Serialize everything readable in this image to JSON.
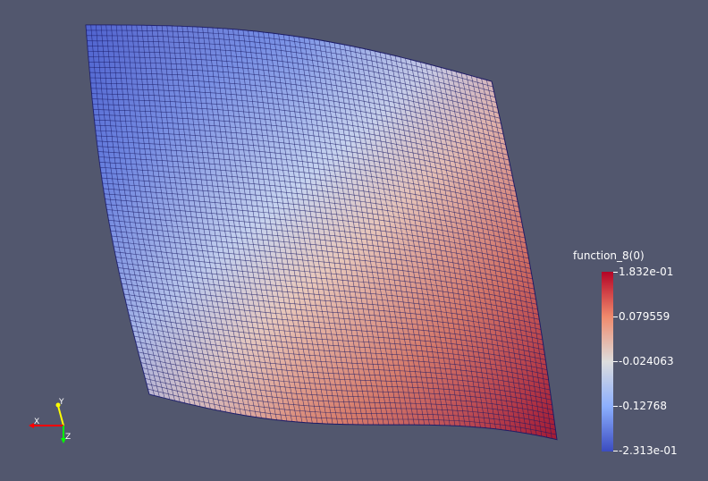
{
  "legend": {
    "title": "function_8(0)",
    "ticks": [
      "1.832e-01",
      "0.079559",
      "-0.024063",
      "-0.12768",
      "-2.313e-01"
    ],
    "colors": {
      "high": "#b40426",
      "mid": "#dddddd",
      "low": "#3b4cc0"
    }
  },
  "axes": {
    "x_label": "X",
    "y_label": "Y",
    "z_label": "Z",
    "x_color": "#ff0000",
    "y_color": "#ffff00",
    "z_color": "#00ff00"
  },
  "colors": {
    "background": "#52576e",
    "mesh_line": "#1a1a66"
  }
}
